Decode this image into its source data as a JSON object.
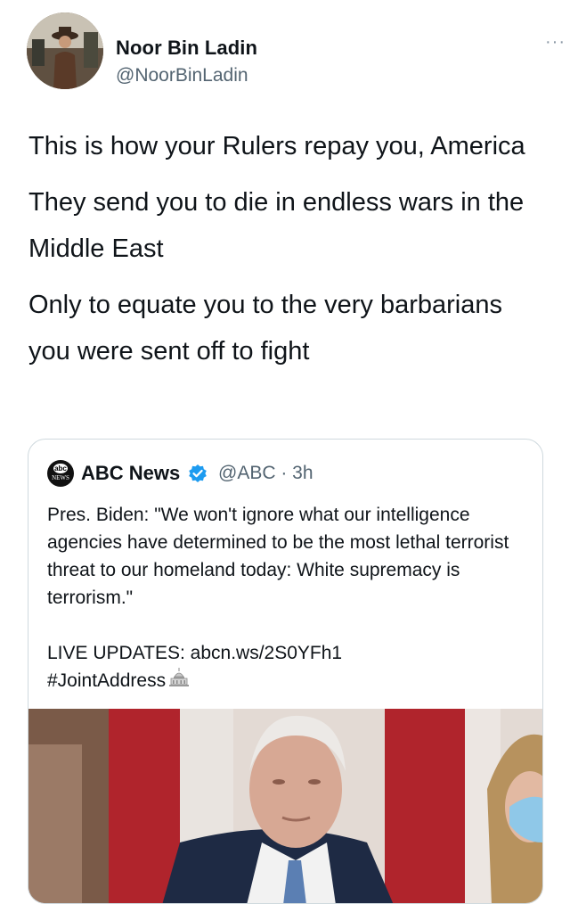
{
  "author": {
    "name": "Noor Bin Ladin",
    "handle": "@NoorBinLadin",
    "more_icon": "more-icon"
  },
  "tweet": {
    "paragraphs": [
      "This is how your Rulers repay you, America",
      "They send you to die in endless wars in the Middle East",
      "Only to equate you to the very barbarians you were sent off to fight"
    ]
  },
  "quote": {
    "name": "ABC News",
    "handle_time": "@ABC · 3h",
    "logo_top": "abc",
    "logo_bottom": "NEWS",
    "text": "Pres. Biden: \"We won't ignore what our intelligence agencies have determined to be the most lethal terrorist threat to our homeland today: White supremacy is terrorism.\"",
    "live_updates": "LIVE UPDATES: abcn.ws/2S0YFh1",
    "hashtag": "#JointAddress",
    "colors": {
      "verified": "#1d9bf0",
      "flag_red": "#b0242c"
    }
  }
}
